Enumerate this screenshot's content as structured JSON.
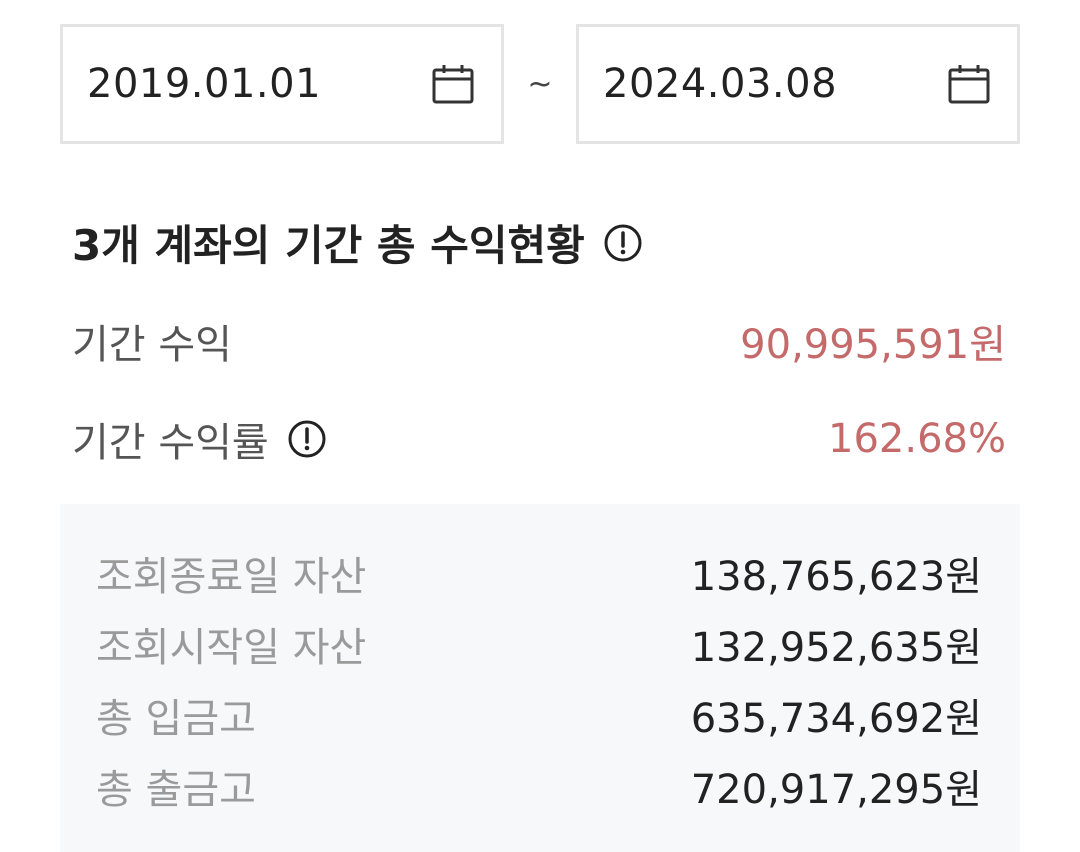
{
  "date_range": {
    "start": "2019.01.01",
    "separator": "~",
    "end": "2024.03.08",
    "icon": "calendar-icon"
  },
  "section": {
    "title": "3개 계좌의 기간 총 수익현황",
    "info_icon": "info-circle-icon"
  },
  "stats": {
    "period_profit_label": "기간 수익",
    "period_profit_value": "90,995,591원",
    "period_return_label": "기간 수익률",
    "period_return_value": "162.68%"
  },
  "summary": {
    "items": [
      {
        "label": "조회종료일 자산",
        "value": "138,765,623원"
      },
      {
        "label": "조회시작일 자산",
        "value": "132,952,635원"
      },
      {
        "label": "총 입금고",
        "value": "635,734,692원"
      },
      {
        "label": "총 출금고",
        "value": "720,917,295원"
      }
    ]
  },
  "colors": {
    "accent_profit": "#c56a6a",
    "summary_bg": "#f7f8fa",
    "border": "#e4e4e4"
  }
}
